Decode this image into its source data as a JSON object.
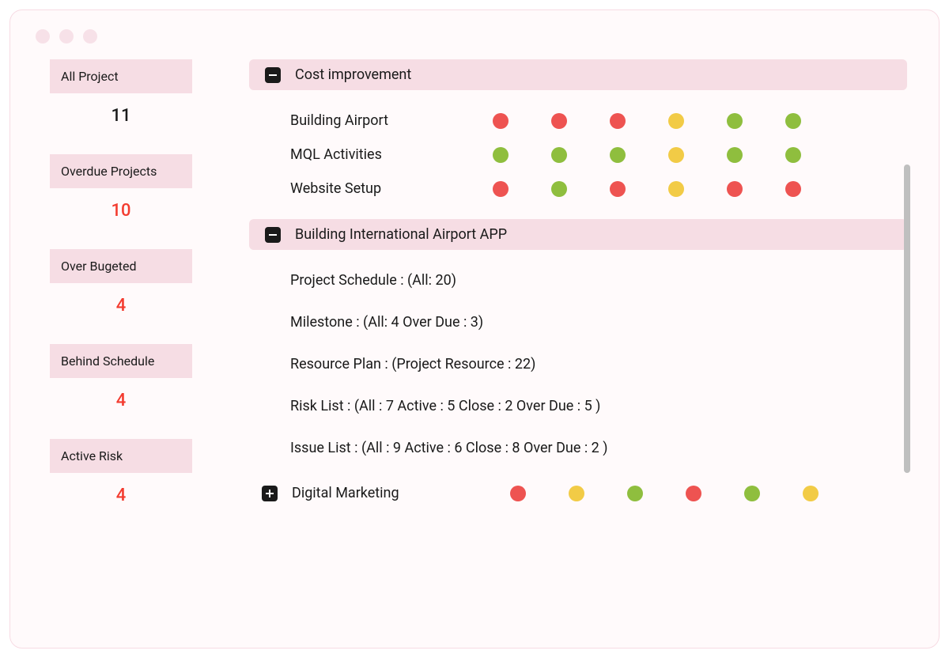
{
  "colors": {
    "red": "#ee5351",
    "green": "#8fbe3e",
    "yellow": "#f2cb46"
  },
  "sidebar": {
    "metrics": [
      {
        "label": "All Project",
        "value": "11",
        "redValue": false
      },
      {
        "label": "Overdue Projects",
        "value": "10",
        "redValue": true
      },
      {
        "label": "Over Bugeted",
        "value": "4",
        "redValue": true
      },
      {
        "label": "Behind Schedule",
        "value": "4",
        "redValue": true
      },
      {
        "label": "Active Risk",
        "value": "4",
        "redValue": true
      }
    ]
  },
  "groups": {
    "costImprovement": {
      "title": "Cost improvement",
      "expanded": true,
      "projects": [
        {
          "name": "Building Airport",
          "status": [
            "red",
            "red",
            "red",
            "yellow",
            "green",
            "green"
          ]
        },
        {
          "name": "MQL Activities",
          "status": [
            "green",
            "green",
            "green",
            "yellow",
            "green",
            "green"
          ]
        },
        {
          "name": "Website Setup",
          "status": [
            "red",
            "green",
            "red",
            "yellow",
            "red",
            "red"
          ]
        }
      ]
    },
    "buildingAirport": {
      "title": "Building International Airport APP",
      "expanded": true,
      "details": [
        "Project Schedule : (All: 20)",
        "Milestone : (All: 4  Over Due : 3)",
        "Resource Plan : (Project Resource : 22)",
        "Risk List : (All : 7  Active : 5   Close : 2   Over Due : 5 )",
        "Issue List : (All : 9  Active : 6   Close : 8   Over Due : 2 )"
      ]
    },
    "digitalMarketing": {
      "title": "Digital Marketing",
      "expanded": false,
      "status": [
        "red",
        "yellow",
        "green",
        "red",
        "green",
        "yellow"
      ]
    }
  }
}
